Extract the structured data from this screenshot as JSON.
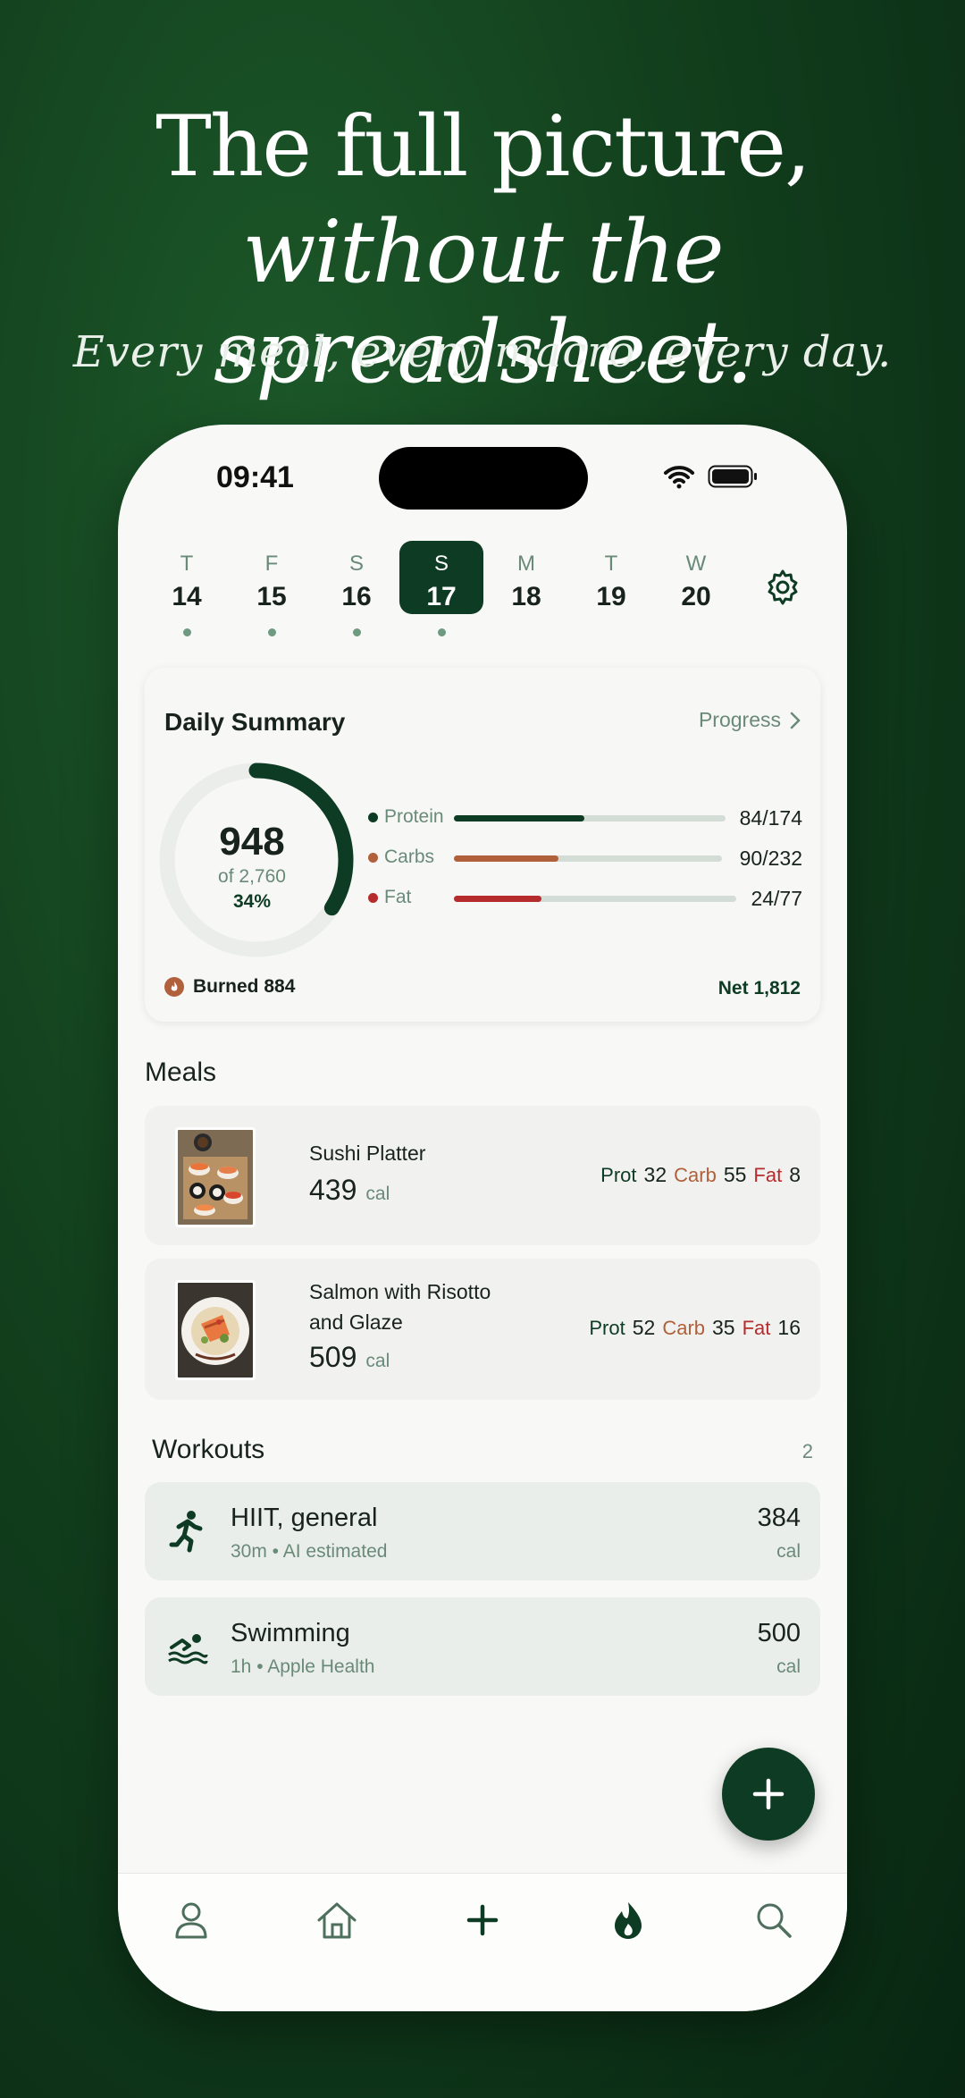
{
  "headline": {
    "line1": "The full picture,",
    "line2": "without the spreadsheet.",
    "tagline": "Every meal, every macro, every day."
  },
  "status_bar": {
    "time": "09:41"
  },
  "week": [
    {
      "letter": "T",
      "date": "14",
      "has_entries": true
    },
    {
      "letter": "F",
      "date": "15",
      "has_entries": true
    },
    {
      "letter": "S",
      "date": "16",
      "has_entries": true
    },
    {
      "letter": "S",
      "date": "17",
      "has_entries": true,
      "selected": true
    },
    {
      "letter": "M",
      "date": "18",
      "has_entries": false
    },
    {
      "letter": "T",
      "date": "19",
      "has_entries": false
    },
    {
      "letter": "W",
      "date": "20",
      "has_entries": false
    }
  ],
  "summary": {
    "title": "Daily Summary",
    "progress_link": "Progress",
    "calories": "948",
    "goal_text": "of 2,760",
    "percent_text": "34%",
    "percent_value": 0.34,
    "macros": [
      {
        "name": "Protein",
        "value_text": "84/174",
        "fraction": 0.48,
        "color": "#0e3b23"
      },
      {
        "name": "Carbs",
        "value_text": "90/232",
        "fraction": 0.39,
        "color": "#b0603a"
      },
      {
        "name": "Fat",
        "value_text": "24/77",
        "fraction": 0.31,
        "color": "#b62b2b"
      }
    ],
    "burned": "Burned 884",
    "net": "Net 1,812"
  },
  "meals": {
    "title": "Meals",
    "items": [
      {
        "name": "Sushi Platter",
        "cal": "439",
        "unit": "cal",
        "prot_label": "Prot",
        "prot": "32",
        "carb_label": "Carb",
        "carb": "55",
        "fat_label": "Fat",
        "fat": "8"
      },
      {
        "name": "Salmon with Risotto and Glaze",
        "cal": "509",
        "unit": "cal",
        "prot_label": "Prot",
        "prot": "52",
        "carb_label": "Carb",
        "carb": "35",
        "fat_label": "Fat",
        "fat": "16"
      }
    ]
  },
  "workouts": {
    "title": "Workouts",
    "count": "2",
    "items": [
      {
        "name": "HIIT, general",
        "meta": "30m • AI estimated",
        "value": "384",
        "unit": "cal",
        "icon": "running-icon"
      },
      {
        "name": "Swimming",
        "meta": "1h • Apple Health",
        "value": "500",
        "unit": "cal",
        "icon": "swimming-icon"
      }
    ]
  },
  "colors": {
    "accent": "#0e3b23",
    "carb": "#b0603a",
    "fat": "#b62b2b",
    "muted": "#6a8a78"
  },
  "tabbar": [
    "profile-icon",
    "home-icon",
    "plus-icon",
    "flame-icon",
    "search-icon"
  ]
}
